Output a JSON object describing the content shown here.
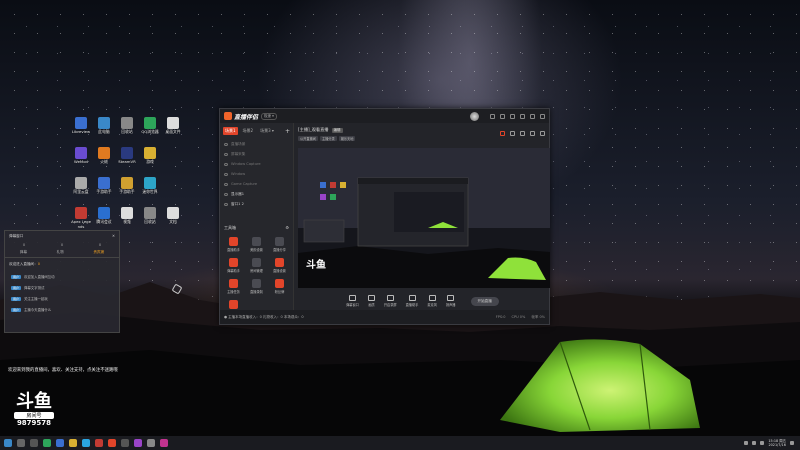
{
  "window": {
    "app_title": "直播伴侣",
    "version_badge": "极速 ▾",
    "tabs": [
      "场景1",
      "场景2",
      "场景3 ▾"
    ],
    "tab_add": "+",
    "scenes": [
      "直播场景",
      "屏幕采集",
      "Window Capture",
      "Window",
      "Game Capture",
      "显示器1",
      "窗口1 2"
    ],
    "tools_heading": "工具箱",
    "tools": [
      "直播助手",
      "美颜设置",
      "直播分享",
      "弹幕助手",
      "房间管理",
      "直播设置",
      "主播任务",
      "直播录制",
      "粉丝牌",
      "主播"
    ],
    "live_title": "[主播]_观看直播",
    "live_tag": "编辑",
    "chips": [
      "公开直播间",
      "主播分类",
      "娱乐天地"
    ],
    "controls": [
      "弹幕窗口",
      "画质",
      "开启录屏",
      "直播助手",
      "麦克风",
      "扬声器"
    ],
    "go_live": "开始直播",
    "status_left": "● 主播本场直播收入：0  礼物收入：0  本场观众：0",
    "status_right": [
      "FPS:0",
      "CPU 0%",
      "帧率 0%"
    ]
  },
  "chat_panel": {
    "title": "弹幕窗口",
    "stats": [
      "0",
      "0",
      "0"
    ],
    "tabs": [
      "弹幕",
      "礼物",
      "贵宾席"
    ],
    "welcome_prefix": "欢迎进入直播间：",
    "welcome_name": "0",
    "messages": [
      {
        "badge": "用户",
        "text": "欢迎加入直播间互动"
      },
      {
        "badge": "用户",
        "text": "弹幕文字测试"
      },
      {
        "badge": "用户",
        "text": "关注主播一起玩"
      },
      {
        "badge": "用户",
        "text": "主播今天直播什么"
      }
    ]
  },
  "announcement": "欢迎来到我的直播间，喜欢、关注支持，点关注不迷路哦",
  "douyu": {
    "logo": "斗鱼",
    "tag": "房间号",
    "room_number": "9879578"
  },
  "desktop_icons": [
    "Libreview",
    "此电脑",
    "回收站",
    "QQ浏览器",
    "桌面文件",
    "WeMod",
    "火绒",
    "SteamVR",
    "游戏",
    "",
    "阿里云盘",
    "手游助手",
    "手游助手",
    "迷你世界",
    "",
    "Apex Legends",
    "腾讯会议",
    "视频",
    "回收站",
    "文档"
  ],
  "taskbar": {
    "clock_time": "15:18 周五",
    "clock_date": "2021/7/16"
  },
  "colors": {
    "accent": "#e2452a",
    "tent": "#8fe13a"
  }
}
